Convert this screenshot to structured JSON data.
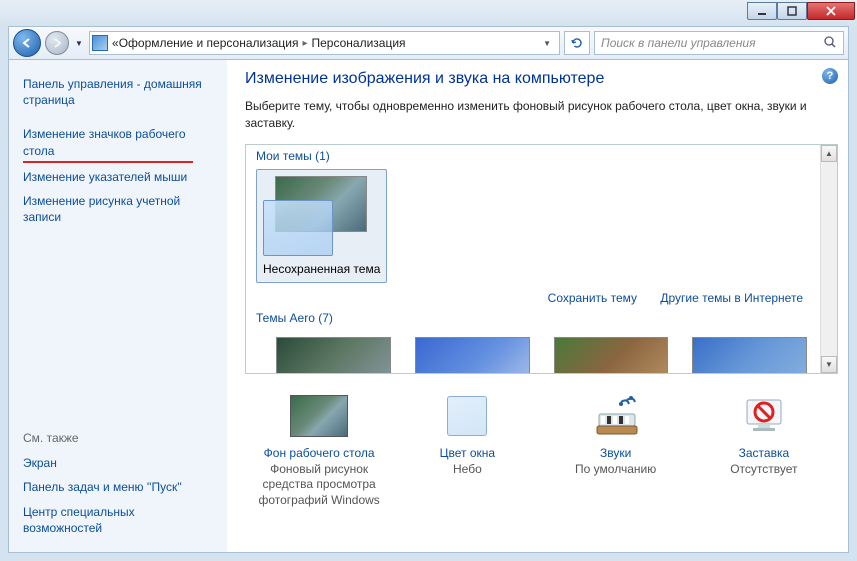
{
  "window": {
    "minimize_tip": "Свернуть",
    "maximize_tip": "Развернуть",
    "close_tip": "Закрыть"
  },
  "nav": {
    "back_tip": "Назад",
    "forward_tip": "Вперёд",
    "breadcrumb_prefix": "«",
    "breadcrumb_1": "Оформление и персонализация",
    "breadcrumb_2": "Персонализация",
    "refresh_tip": "Обновить",
    "search_placeholder": "Поиск в панели управления"
  },
  "sidebar": {
    "home": "Панель управления - домашняя страница",
    "icons": "Изменение значков рабочего стола",
    "pointers": "Изменение указателей мыши",
    "account_pic": "Изменение рисунка учетной записи",
    "see_also": "См. также",
    "screen": "Экран",
    "taskbar": "Панель задач и меню ''Пуск''",
    "ease": "Центр специальных возможностей"
  },
  "content": {
    "help_tip": "Справка",
    "title": "Изменение изображения и звука на компьютере",
    "desc": "Выберите тему, чтобы одновременно изменить фоновый рисунок рабочего стола, цвет окна, звуки и заставку.",
    "my_themes_header": "Мои темы (1)",
    "unsaved_theme": "Несохраненная тема",
    "save_theme": "Сохранить тему",
    "more_themes": "Другие темы в Интернете",
    "aero_header": "Темы Aero (7)"
  },
  "opts": {
    "bg_title": "Фон рабочего стола",
    "bg_sub": "Фоновый рисунок средства просмотра фотографий Windows",
    "color_title": "Цвет окна",
    "color_sub": "Небо",
    "sounds_title": "Звуки",
    "sounds_sub": "По умолчанию",
    "saver_title": "Заставка",
    "saver_sub": "Отсутствует"
  }
}
